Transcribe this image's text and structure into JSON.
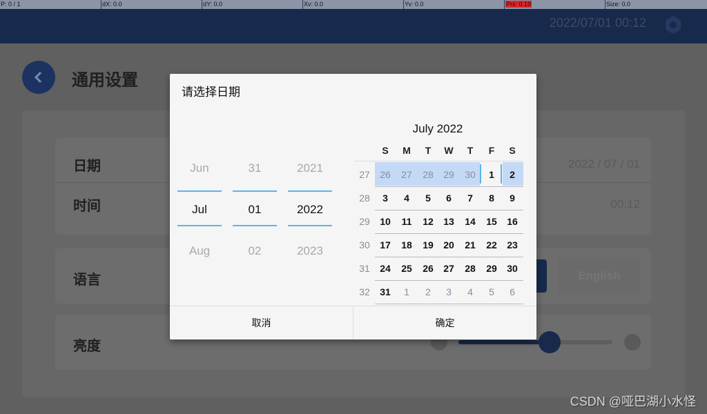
{
  "status_bar": [
    "P: 0 / 1",
    "dX: 0.0",
    "dY: 0.0",
    "Xv: 0.0",
    "Yv: 0.0",
    "Prs: 0.19",
    "Size: 0.0"
  ],
  "header": {
    "datetime": "2022/07/01  00:12",
    "icon": "settings-hex-icon"
  },
  "page": {
    "title": "通用设置",
    "back_icon": "chevron-left-icon"
  },
  "settings": {
    "date_label": "日期",
    "date_value": "2022 / 07 / 01",
    "time_label": "时间",
    "time_value": "00:12",
    "language_label": "语言",
    "language_option": "English",
    "brightness_label": "亮度",
    "brightness_percent": 59
  },
  "dialog": {
    "title": "请选择日期",
    "picker": {
      "month": [
        "Jun",
        "Jul",
        "Aug"
      ],
      "day": [
        "31",
        "01",
        "02"
      ],
      "year": [
        "2021",
        "2022",
        "2023"
      ]
    },
    "calendar": {
      "title": "July 2022",
      "weekdays": [
        "S",
        "M",
        "T",
        "W",
        "T",
        "F",
        "S"
      ],
      "weeks": [
        {
          "no": "27",
          "days": [
            "26",
            "27",
            "28",
            "29",
            "30",
            "1",
            "2"
          ]
        },
        {
          "no": "28",
          "days": [
            "3",
            "4",
            "5",
            "6",
            "7",
            "8",
            "9"
          ]
        },
        {
          "no": "29",
          "days": [
            "10",
            "11",
            "12",
            "13",
            "14",
            "15",
            "16"
          ]
        },
        {
          "no": "30",
          "days": [
            "17",
            "18",
            "19",
            "20",
            "21",
            "22",
            "23"
          ]
        },
        {
          "no": "31",
          "days": [
            "24",
            "25",
            "26",
            "27",
            "28",
            "29",
            "30"
          ]
        },
        {
          "no": "32",
          "days": [
            "31",
            "1",
            "2",
            "3",
            "4",
            "5",
            "6"
          ]
        }
      ],
      "selected": "1"
    },
    "cancel": "取消",
    "ok": "确定"
  },
  "watermark": "CSDN @哑巴湖小水怪",
  "colors": {
    "header": "#172a4b",
    "accent": "#5bb5e6",
    "highlight": "#c4d9f5"
  }
}
